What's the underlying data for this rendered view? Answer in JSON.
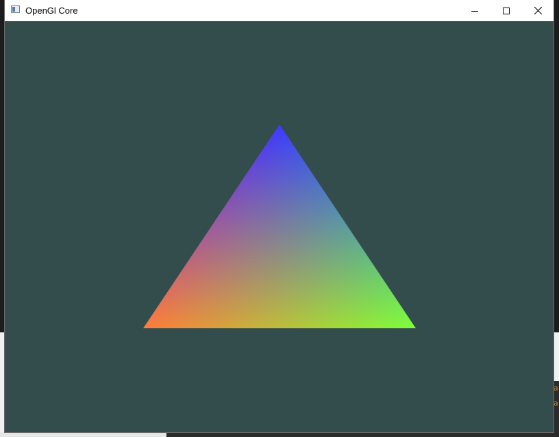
{
  "window": {
    "title": "OpenGl Core"
  },
  "controls": {
    "minimize_icon": "minimize-icon",
    "maximize_icon": "maximize-icon",
    "close_icon": "close-icon"
  },
  "scene": {
    "clear_color": "#334d4d",
    "triangle_vertex_colors": {
      "top": "#0000ff",
      "bottom_left": "#ff0000",
      "bottom_right": "#00ff00"
    }
  },
  "background_editor": {
    "visible_chars": "a\na"
  }
}
